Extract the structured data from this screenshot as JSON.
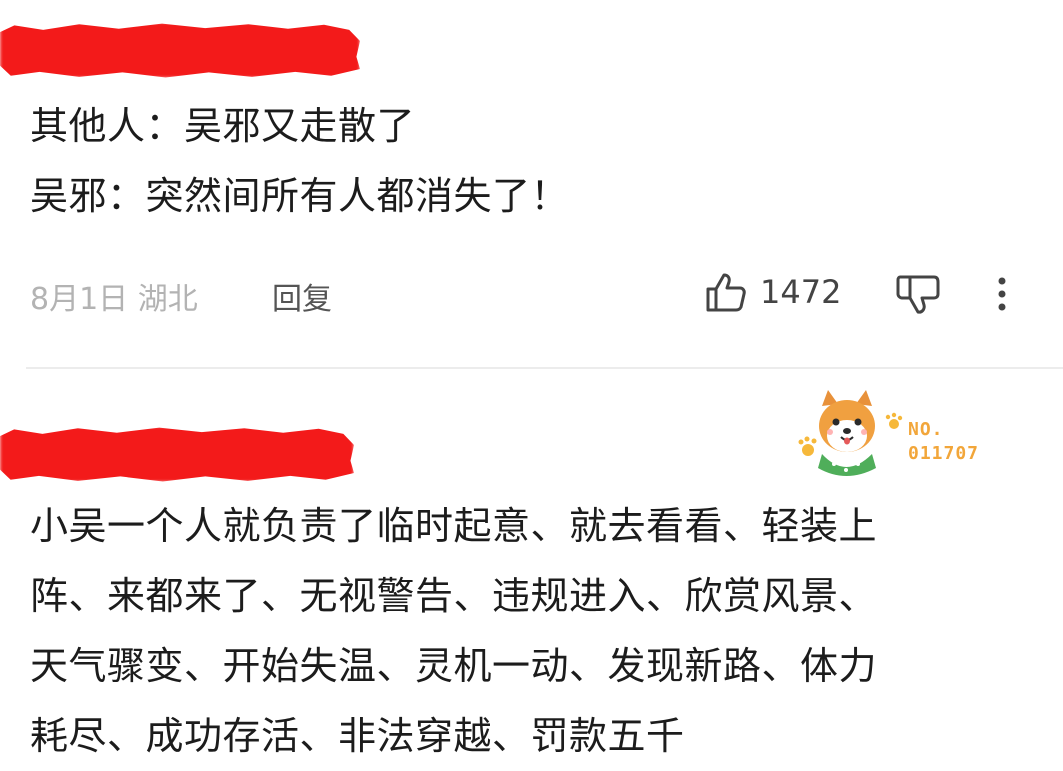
{
  "comments": [
    {
      "text_lines": [
        "其他人：吴邪又走散了",
        "吴邪：突然间所有人都消失了！"
      ],
      "date_location": "8月1日 湖北",
      "reply_label": "回复",
      "like_count": "1472"
    },
    {
      "badge": {
        "no_label": "NO.",
        "number": "011707"
      },
      "text_lines": [
        "小吴一个人就负责了临时起意、就去看看、轻装上",
        "阵、来都来了、无视警告、违规进入、欣赏风景、",
        "天气骤变、开始失温、灵机一动、发现新路、体力",
        "耗尽、成功存活、非法穿越、罚款五千"
      ]
    }
  ],
  "colors": {
    "redaction": "#f31a1a",
    "badge_accent": "#f2a63a",
    "meta_text": "#b3b3b3"
  },
  "icons": [
    "thumbs-up-icon",
    "thumbs-down-icon",
    "more-vertical-icon",
    "shiba-dog-sticker"
  ]
}
